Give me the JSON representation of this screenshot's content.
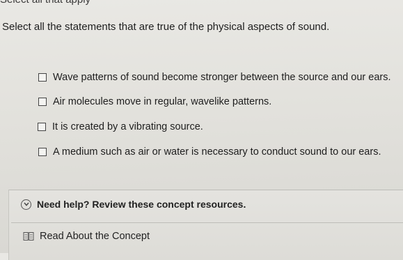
{
  "header": {
    "partial_title": "Select all that apply"
  },
  "question": {
    "prompt": "Select all the statements that are true of the physical aspects of sound."
  },
  "options": [
    {
      "label": "Wave patterns of sound become stronger between the source and our ears.",
      "checked": false
    },
    {
      "label": "Air molecules move in regular, wavelike patterns.",
      "checked": false
    },
    {
      "label": "It is created by a vibrating source.",
      "checked": false
    },
    {
      "label": "A medium such as air or water is necessary to conduct sound to our ears.",
      "checked": false
    }
  ],
  "help": {
    "label": "Need help? Review these concept resources.",
    "toggle_icon": "chevron-down-circle-icon",
    "resources": [
      {
        "label": "Read About the Concept",
        "icon": "book-icon"
      }
    ]
  }
}
